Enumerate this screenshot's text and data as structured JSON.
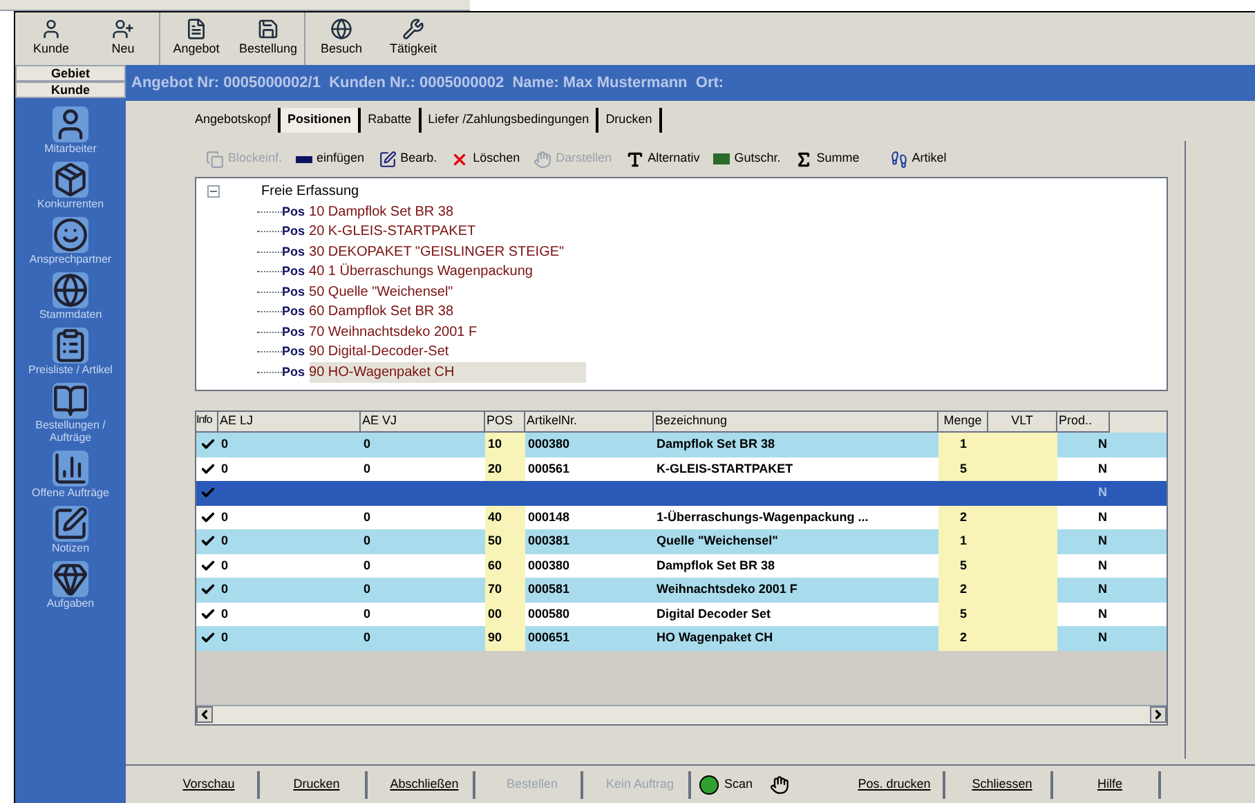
{
  "toolbar": [
    {
      "items": [
        {
          "label": "Kunde"
        },
        {
          "label": "Neu"
        }
      ]
    },
    {
      "items": [
        {
          "label": "Angebot"
        },
        {
          "label": "Bestellung"
        }
      ]
    },
    {
      "items": [
        {
          "label": "Besuch"
        },
        {
          "label": "Tätigkeit"
        }
      ]
    }
  ],
  "side_tabs": [
    "Gebiet",
    "Kunde"
  ],
  "sidebar": {
    "items": [
      {
        "label": "Mitarbeiter"
      },
      {
        "label": "Konkurrenten"
      },
      {
        "label": "Ansprechpartner"
      },
      {
        "label": "Stammdaten"
      },
      {
        "label": "Preisliste / Artikel"
      },
      {
        "label": "Bestellungen / Aufträge"
      },
      {
        "label": "Offene Aufträge"
      },
      {
        "label": "Notizen"
      },
      {
        "label": "Aufgaben"
      }
    ]
  },
  "header": "Angebot Nr: 0005000002/1  Kunden Nr.: 0005000002  Name: Max Mustermann  Ort:",
  "tabs": [
    {
      "label": "Angebotskopf",
      "selected": false
    },
    {
      "label": "Positionen",
      "selected": true
    },
    {
      "label": "Rabatte",
      "selected": false
    },
    {
      "label": "Liefer /Zahlungsbedingungen",
      "selected": false
    },
    {
      "label": "Drucken",
      "selected": false
    }
  ],
  "panel_toolbar": [
    {
      "label": "Blockeinf.",
      "disabled": true
    },
    {
      "label": "einfügen",
      "disabled": false
    },
    {
      "label": "Bearb.",
      "disabled": false
    },
    {
      "label": "Löschen",
      "disabled": false
    },
    {
      "label": "Darstellen",
      "disabled": true
    },
    {
      "label": "Alternativ",
      "disabled": false
    },
    {
      "label": "Gutschr.",
      "disabled": false
    },
    {
      "label": "Summe",
      "disabled": false
    },
    {
      "label": "Artikel",
      "disabled": false
    }
  ],
  "tree": {
    "label": "Freie Erfassung",
    "expanded": true,
    "children": [
      {
        "tag": "Pos",
        "label": "10 Dampflok Set BR 38",
        "selected": false
      },
      {
        "tag": "Pos",
        "label": "20 K-GLEIS-STARTPAKET",
        "selected": false
      },
      {
        "tag": "Pos",
        "label": "30 DEKOPAKET \"GEISLINGER STEIGE\"",
        "selected": false
      },
      {
        "tag": "Pos",
        "label": "40 1 Überraschungs Wagenpackung",
        "selected": false
      },
      {
        "tag": "Pos",
        "label": "50 Quelle \"Weichensel\"",
        "selected": false
      },
      {
        "tag": "Pos",
        "label": "60 Dampflok Set BR 38",
        "selected": false
      },
      {
        "tag": "Pos",
        "label": "70 Weihnachtsdeko 2001 F",
        "selected": false
      },
      {
        "tag": "Pos",
        "label": "90 Digital-Decoder-Set",
        "selected": false
      },
      {
        "tag": "Pos",
        "label": "90 HO-Wagenpaket CH",
        "selected": true
      }
    ]
  },
  "table": {
    "info_header": "Info",
    "columns": [
      "AE LJ",
      "AE VJ",
      "POS",
      "ArtikelNr.",
      "Bezeichnung",
      "Menge",
      "VLT",
      "Prod.."
    ],
    "rows": [
      {
        "checked": true,
        "selected": false,
        "cells": [
          "0",
          "0",
          "10",
          "000380",
          "Dampflok Set BR 38",
          "1",
          "",
          "N"
        ]
      },
      {
        "checked": true,
        "selected": false,
        "cells": [
          "0",
          "0",
          "20",
          "000561",
          "K-GLEIS-STARTPAKET",
          "5",
          "",
          "N"
        ]
      },
      {
        "checked": true,
        "selected": true,
        "cells": [
          "",
          "",
          "",
          "",
          "",
          "",
          "",
          "N"
        ]
      },
      {
        "checked": true,
        "selected": false,
        "cells": [
          "0",
          "0",
          "40",
          "000148",
          "1-Überraschungs-Wagenpackung  ...",
          "2",
          "",
          "N"
        ]
      },
      {
        "checked": true,
        "selected": false,
        "cells": [
          "0",
          "0",
          "50",
          "000381",
          "Quelle \"Weichensel\"",
          "1",
          "",
          "N"
        ]
      },
      {
        "checked": true,
        "selected": false,
        "cells": [
          "0",
          "0",
          "60",
          "000380",
          "Dampflok Set BR 38",
          "5",
          "",
          "N"
        ]
      },
      {
        "checked": true,
        "selected": false,
        "cells": [
          "0",
          "0",
          "70",
          "000581",
          "Weihnachtsdeko 2001 F",
          "2",
          "",
          "N"
        ]
      },
      {
        "checked": true,
        "selected": false,
        "cells": [
          "0",
          "0",
          "00",
          "000580",
          "Digital Decoder Set",
          "5",
          "",
          "N"
        ]
      },
      {
        "checked": true,
        "selected": false,
        "cells": [
          "0",
          "0",
          "90",
          "000651",
          "HO Wagenpaket CH",
          "2",
          "",
          "N"
        ]
      }
    ]
  },
  "buttons": [
    {
      "label": "Vorschau",
      "kind": "button",
      "disabled": false
    },
    {
      "label": "Drucken",
      "kind": "button",
      "disabled": false
    },
    {
      "label": "Abschließen",
      "kind": "button",
      "disabled": false
    },
    {
      "label": "Bestellen",
      "kind": "button",
      "disabled": true
    },
    {
      "label": "Kein Auftrag",
      "kind": "button",
      "disabled": true
    },
    {
      "label": "Scan",
      "kind": "scan",
      "disabled": false
    },
    {
      "label": "Pos. drucken",
      "kind": "button",
      "disabled": false
    },
    {
      "label": "Schliessen",
      "kind": "button",
      "disabled": false
    },
    {
      "label": "Hilfe",
      "kind": "button",
      "disabled": false
    }
  ]
}
